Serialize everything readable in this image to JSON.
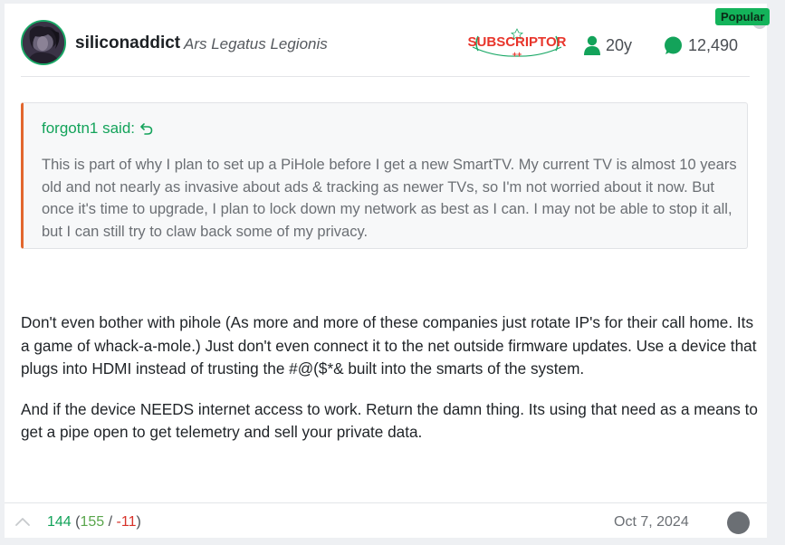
{
  "post": {
    "badge": "Popular",
    "author": {
      "username": "siliconaddict",
      "title": "Ars Legatus Legionis",
      "subscriber_badge": "SUBSCRIPTOR",
      "subscriber_mark": "++",
      "years": "20y",
      "post_count": "12,490",
      "avatar_icon": "avatar-image"
    },
    "quote": {
      "attribution": "forgotn1 said:",
      "jump_icon": "return-arrow-icon",
      "text": "This is part of why I plan to set up a PiHole before I get a new SmartTV. My current TV is almost 10 years old and not nearly as invasive about ads & tracking as newer TVs, so I'm not worried about it now. But once it's time to upgrade, I plan to lock down my network as best as I can. I may not be able to stop it all, but I can still try to claw back some of my privacy."
    },
    "body": [
      "Don't even bother with pihole (As more and more of these companies just rotate IP's for their call home. Its a game of whack-a-mole.) Just don't even connect it to the net outside firmware updates. Use a device that plugs into HDMI instead of trusting the #@($*& built into the smarts of the system.",
      "And if the device NEEDS internet access to work. Return the damn thing. Its using that need as a means to get a pipe open to get telemetry and sell your private data."
    ],
    "footer": {
      "score": "144",
      "open_paren": "(",
      "upvotes": "155",
      "separator": " / ",
      "downvotes": "-11",
      "close_paren": ")",
      "date": "Oct 7, 2024"
    },
    "colors": {
      "accent_green": "#13a35a",
      "quote_border": "#e2672e",
      "subscriptor_red": "#e8352b",
      "downvote_red": "#d7322a"
    }
  }
}
